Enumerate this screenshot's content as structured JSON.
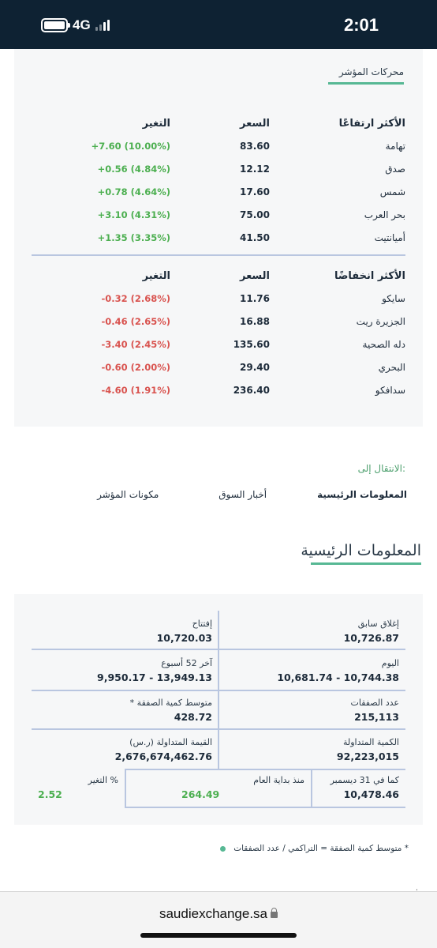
{
  "status": {
    "network": "4G",
    "time": "2:01"
  },
  "movers": {
    "title": "محركات المؤشر",
    "gainers": {
      "header": {
        "name": "الأكثر ارتفاعًا",
        "price": "السعر",
        "change": "التغير"
      },
      "rows": [
        {
          "name": "تهامة",
          "price": "83.60",
          "change": "+7.60 (10.00%)"
        },
        {
          "name": "صدق",
          "price": "12.12",
          "change": "+0.56 (4.84%)"
        },
        {
          "name": "شمس",
          "price": "17.60",
          "change": "+0.78 (4.64%)"
        },
        {
          "name": "بحر العرب",
          "price": "75.00",
          "change": "+3.10 (4.31%)"
        },
        {
          "name": "أميانتيت",
          "price": "41.50",
          "change": "+1.35 (3.35%)"
        }
      ]
    },
    "losers": {
      "header": {
        "name": "الأكثر انخفاضًا",
        "price": "السعر",
        "change": "التغير"
      },
      "rows": [
        {
          "name": "سايكو",
          "price": "11.76",
          "change": "-0.32 (2.68%)"
        },
        {
          "name": "الجزيرة ريت",
          "price": "16.88",
          "change": "-0.46 (2.65%)"
        },
        {
          "name": "دله الصحية",
          "price": "135.60",
          "change": "-3.40 (2.45%)"
        },
        {
          "name": "البحري",
          "price": "29.40",
          "change": "-0.60 (2.00%)"
        },
        {
          "name": "سدافكو",
          "price": "236.40",
          "change": "-4.60 (1.91%)"
        }
      ]
    }
  },
  "nav": {
    "label": "الانتقال إلى:",
    "links": [
      "المعلومات الرئيسية",
      "أخبار السوق",
      "مكونات المؤشر"
    ]
  },
  "main_info": {
    "title": "المعلومات الرئيسية",
    "prev_close": {
      "label": "إغلاق سابق",
      "value": "10,726.87"
    },
    "open": {
      "label": "إفتتاح",
      "value": "10,720.03"
    },
    "today": {
      "label": "اليوم",
      "value": "10,681.74 - 10,744.38"
    },
    "week52": {
      "label": "آخر 52 أسبوع",
      "value": "9,950.17 - 13,949.13"
    },
    "trades": {
      "label": "عدد الصفقات",
      "value": "215,113"
    },
    "avg_trade": {
      "label": "متوسط كمية الصفقة *",
      "value": "428.72"
    },
    "volume": {
      "label": "الكمية المتداولة",
      "value": "92,223,015"
    },
    "turnover": {
      "label": "القيمة المتداولة (ر.س)",
      "value": "2,676,674,462.76"
    },
    "as_of": {
      "label": "كما في 31 ديسمبر",
      "value": "10,478.46"
    },
    "ytd": {
      "label": "منذ بداية العام",
      "value": "264.49"
    },
    "pct": {
      "label": "% التغير",
      "value": "2.52"
    }
  },
  "footnote": "* متوسط كمية الصفقة = التراكمي / عدد الصفقات",
  "browser": {
    "url": "saudiexchange.sa"
  },
  "colors": {
    "header_bg": "#0e2233",
    "accent": "#57b894",
    "positive": "#4caf50",
    "negative": "#d9534f"
  }
}
